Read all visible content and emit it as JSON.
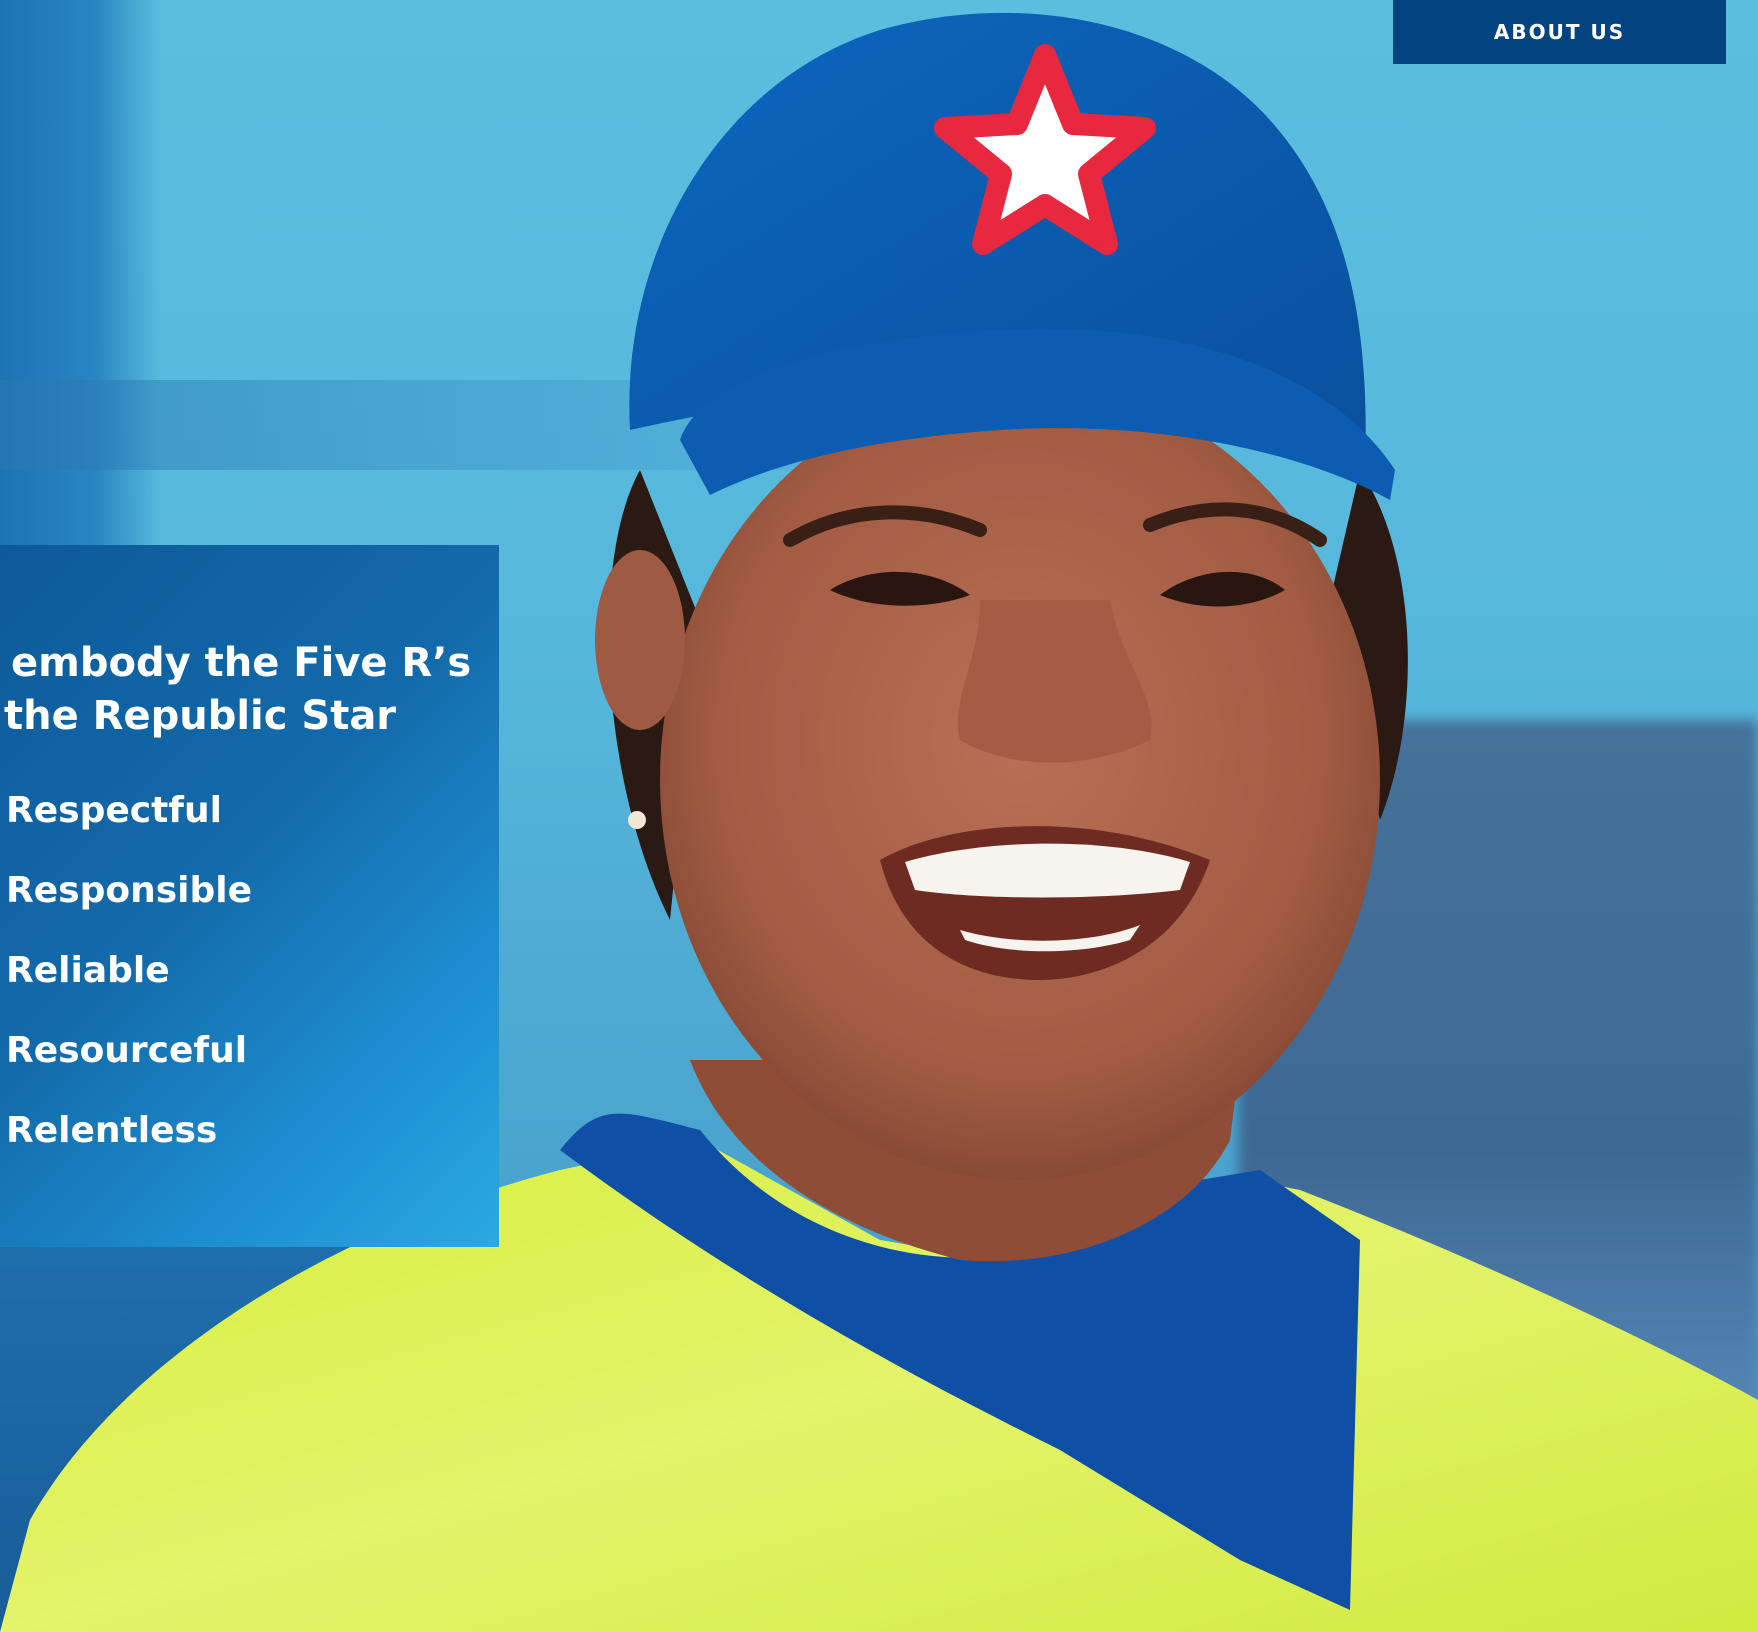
{
  "header": {
    "about_label": "ABOUT US"
  },
  "values_panel": {
    "heading_line1": "e embody the Five R’s",
    "heading_line2": "the Republic Star",
    "items": [
      "Respectful",
      "Responsible",
      "Reliable",
      "Resourceful",
      "Relentless"
    ]
  },
  "colors": {
    "button_bg": "#034380",
    "panel_dark": "#0d5a9a",
    "panel_light": "#2aa9e2",
    "hat_blue": "#0a5fb4",
    "shirt_yellow": "#e6f35a",
    "star_red": "#e8283f"
  },
  "icons": {
    "hat_logo": "republic-star-icon"
  }
}
